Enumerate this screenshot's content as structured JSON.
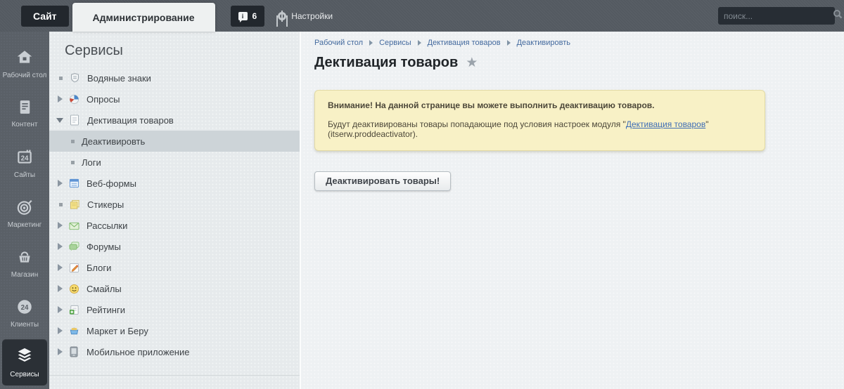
{
  "topbar": {
    "site_tab": "Сайт",
    "admin_tab": "Администрирование",
    "notifications_count": "6",
    "settings_label": "Настройки",
    "search_placeholder": "поиск..."
  },
  "rail": {
    "items": [
      {
        "label": "Рабочий стол",
        "icon": "desktop-home-icon",
        "active": false
      },
      {
        "label": "Контент",
        "icon": "content-document-icon",
        "active": false
      },
      {
        "label": "Сайты",
        "icon": "sites-calendar-icon",
        "active": false
      },
      {
        "label": "Маркетинг",
        "icon": "marketing-target-icon",
        "active": false
      },
      {
        "label": "Магазин",
        "icon": "shop-basket-icon",
        "active": false
      },
      {
        "label": "Клиенты",
        "icon": "clients-24-icon",
        "active": false
      },
      {
        "label": "Сервисы",
        "icon": "services-layers-icon",
        "active": true
      }
    ]
  },
  "servicesMenu": {
    "heading": "Сервисы",
    "items": [
      {
        "label": "Водяные знаки",
        "marker": "bullet",
        "icon": "watermark-shield-icon"
      },
      {
        "label": "Опросы",
        "marker": "collapsed",
        "icon": "polls-pie-icon"
      },
      {
        "label": "Дективация товаров",
        "marker": "expanded",
        "icon": "deactivation-doc-icon"
      },
      {
        "label": "Деактивировть",
        "marker": "bullet",
        "child": true,
        "selected": true
      },
      {
        "label": "Логи",
        "marker": "bullet",
        "child": true
      },
      {
        "label": "Веб-формы",
        "marker": "collapsed",
        "icon": "webforms-icon"
      },
      {
        "label": "Стикеры",
        "marker": "bullet",
        "icon": "stickers-icon"
      },
      {
        "label": "Рассылки",
        "marker": "collapsed",
        "icon": "newsletters-envelope-icon"
      },
      {
        "label": "Форумы",
        "marker": "collapsed",
        "icon": "forums-chat-icon"
      },
      {
        "label": "Блоги",
        "marker": "collapsed",
        "icon": "blogs-pencil-icon"
      },
      {
        "label": "Смайлы",
        "marker": "collapsed",
        "icon": "smiles-smiley-icon"
      },
      {
        "label": "Рейтинги",
        "marker": "collapsed",
        "icon": "ratings-doc-plus-icon"
      },
      {
        "label": "Маркет и Беру",
        "marker": "collapsed",
        "icon": "market-cart-icon"
      },
      {
        "label": "Мобильное приложение",
        "marker": "collapsed",
        "icon": "mobile-app-icon"
      }
    ]
  },
  "content": {
    "breadcrumb": [
      "Рабочий стол",
      "Сервисы",
      "Дективация товаров",
      "Деактивировть"
    ],
    "page_title": "Дективация товаров",
    "warning": {
      "line1": "Внимание! На данной странице вы можете выполнить деактивацию товаров.",
      "line2_prefix": "Будут деактивированы товары попадающие под условия настроек модуля \"",
      "line2_link": "Дективация товаров",
      "line2_suffix": "\" (itserw.proddeactivator)."
    },
    "action_button": "Деактивировать товары!"
  },
  "colors": {
    "topbar_bg": "#545a61",
    "dark_tab_bg": "#22272d",
    "active_tab_bg": "#eef1f1",
    "rail_bg": "#5a6067",
    "rail_active_bg": "#2b3036",
    "panel_bg": "#e6eaec",
    "selected_row_bg": "#cdd4d8",
    "content_bg": "#eef1f3",
    "breadcrumb_link": "#446a9e",
    "warning_bg": "#f8f1c6",
    "warning_border": "#e2daa5",
    "warning_link": "#3e6db5"
  }
}
